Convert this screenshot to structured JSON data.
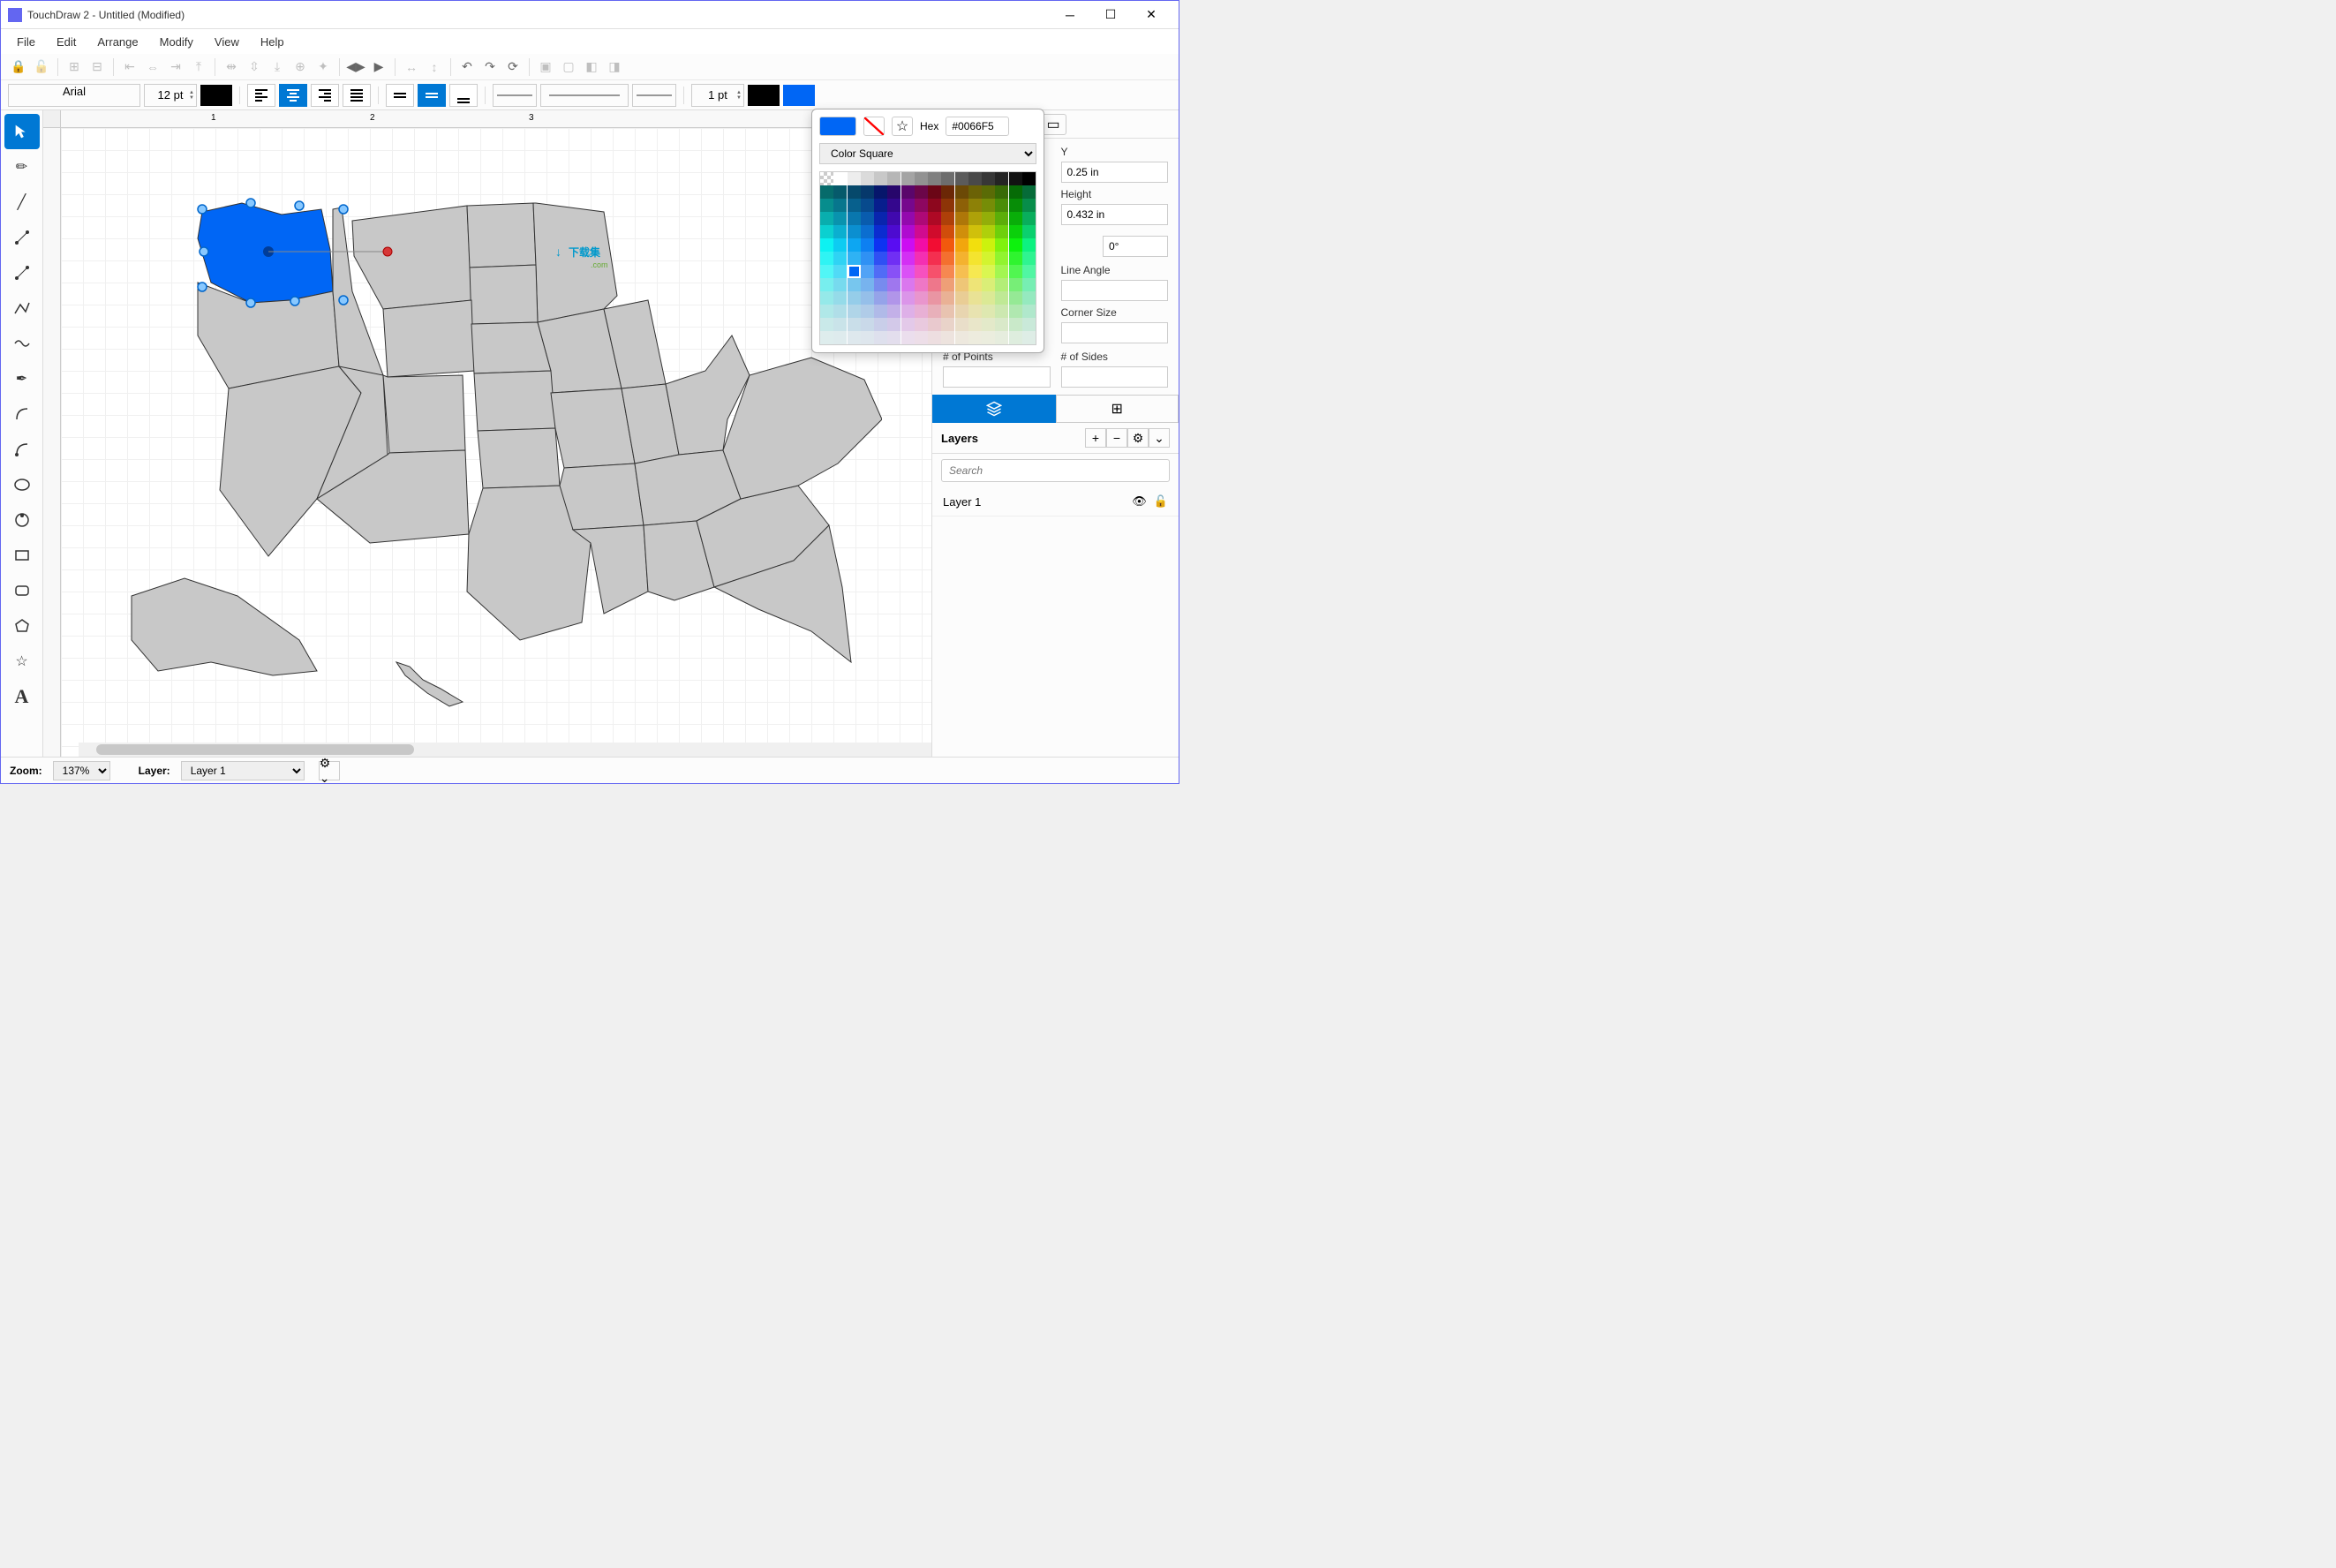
{
  "titlebar": {
    "text": "TouchDraw 2 - Untitled (Modified)"
  },
  "menu": [
    "File",
    "Edit",
    "Arrange",
    "Modify",
    "View",
    "Help"
  ],
  "font": {
    "family": "Arial",
    "size": "12 pt"
  },
  "stroke": {
    "width": "1 pt"
  },
  "fillColor": "#0066F5",
  "colorPicker": {
    "hexLabel": "Hex",
    "hexValue": "#0066F5",
    "mode": "Color Square"
  },
  "inspector": {
    "yLabel": "Y",
    "yValue": "0.25 in",
    "heightLabel": "Height",
    "heightValue": "0.432 in",
    "rotation": "0°",
    "lineAngleLabel": "Line Angle",
    "cornerSizeLabel": "Corner Size",
    "pointsLabel": "# of Points",
    "sidesLabel": "# of Sides"
  },
  "layers": {
    "title": "Layers",
    "searchPlaceholder": "Search",
    "items": [
      "Layer 1"
    ]
  },
  "statusbar": {
    "zoomLabel": "Zoom:",
    "zoomValue": "137%",
    "layerLabel": "Layer:",
    "layerValue": "Layer 1"
  },
  "rulerMarks": [
    "1",
    "2",
    "3"
  ],
  "watermark": "下载集"
}
